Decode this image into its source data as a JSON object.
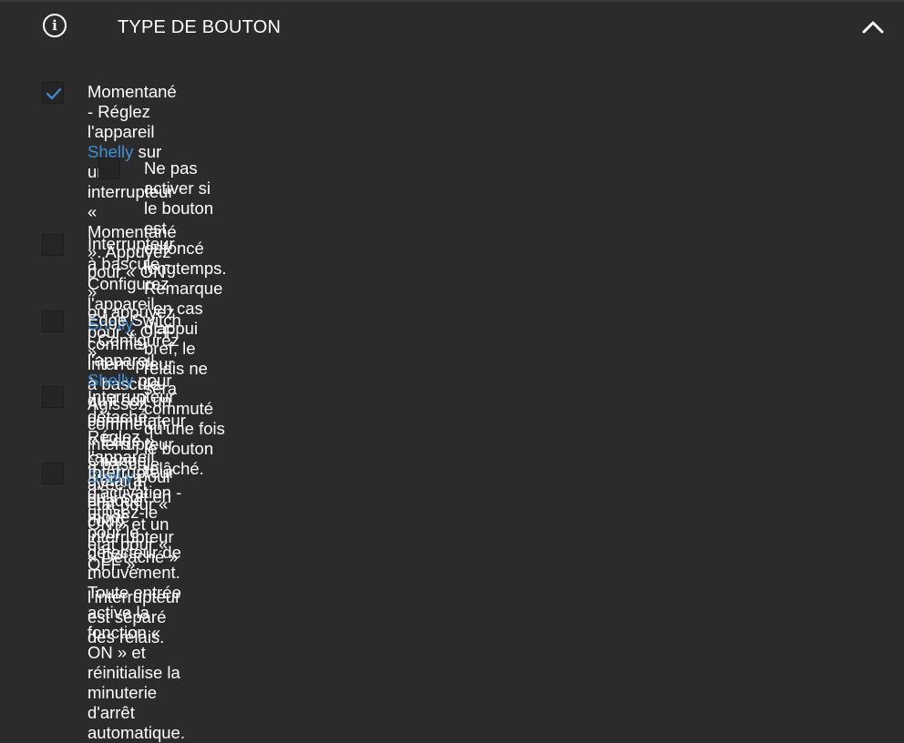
{
  "header": {
    "title": "TYPE DE BOUTON",
    "info_icon": "info-circle-icon",
    "collapse_icon": "chevron-up-icon"
  },
  "colors": {
    "background": "#2b2b2b",
    "brand": "#3f8fd8",
    "check": "#3f8fd8"
  },
  "options": [
    {
      "checked": true,
      "line1_pre": "Momentané - Réglez l'appareil ",
      "brand": "Shelly",
      "line1_post": " sur un interrupteur « Momentané ». Appuyez pour « ON »",
      "line2": "ou appuyez pour « OFF »."
    },
    {
      "checked": false,
      "line1": "Ne pas activer si le bouton est enfoncé longtemps. Remarque : en cas d'appui bref, le",
      "line2": "relais ne sera commuté qu'une fois le bouton relâché."
    },
    {
      "checked": false,
      "line1_pre": "Interrupteur à bascule - Configurez l'appareil ",
      "brand": "Shelly",
      "line1_post": " comme interrupteur à bascule. Agissez",
      "line2": "comme un interrupteur à bascule avec un état pour « ON » et un état pour « OFF »."
    },
    {
      "checked": false,
      "line1_pre": "Edge Switch - Configurez l'appareil ",
      "brand": "Shelly",
      "line1_post": " pour qu'il soit un commutateur « Edge ». Change",
      "line2": "d'état à chaque coup."
    },
    {
      "checked": false,
      "line1_pre": "Interrupteur détaché - Réglez l'appareil ",
      "brand": "Shelly",
      "line1_post": " pour qu'il soit en mode interrupteur « Détaché » -",
      "line2": "l'interrupteur est séparé des relais."
    },
    {
      "checked": false,
      "line1": "Interrupteur d'activation - utilisez-le pour le détecteur de mouvement. Toute entrée active la",
      "line2": "fonction « ON » et réinitialise la minuterie d'arrêt automatique."
    }
  ]
}
